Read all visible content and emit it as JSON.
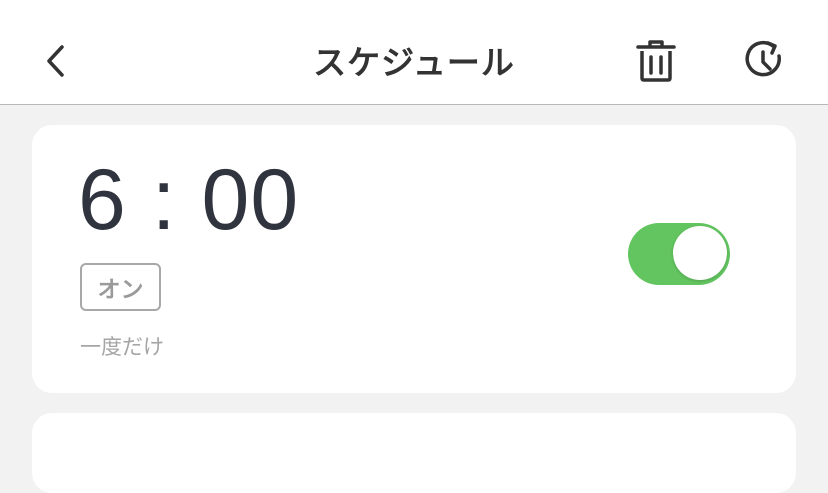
{
  "header": {
    "title": "スケジュール",
    "back_icon": "chevron-left-icon",
    "delete_icon": "trash-icon",
    "history_icon": "clock-history-icon"
  },
  "schedules": [
    {
      "time": "6 : 00",
      "status_badge": "オン",
      "repeat": "一度だけ",
      "enabled": true
    }
  ],
  "colors": {
    "toggle_on": "#63c560",
    "time_text": "#30343f",
    "background": "#f2f2f2"
  }
}
